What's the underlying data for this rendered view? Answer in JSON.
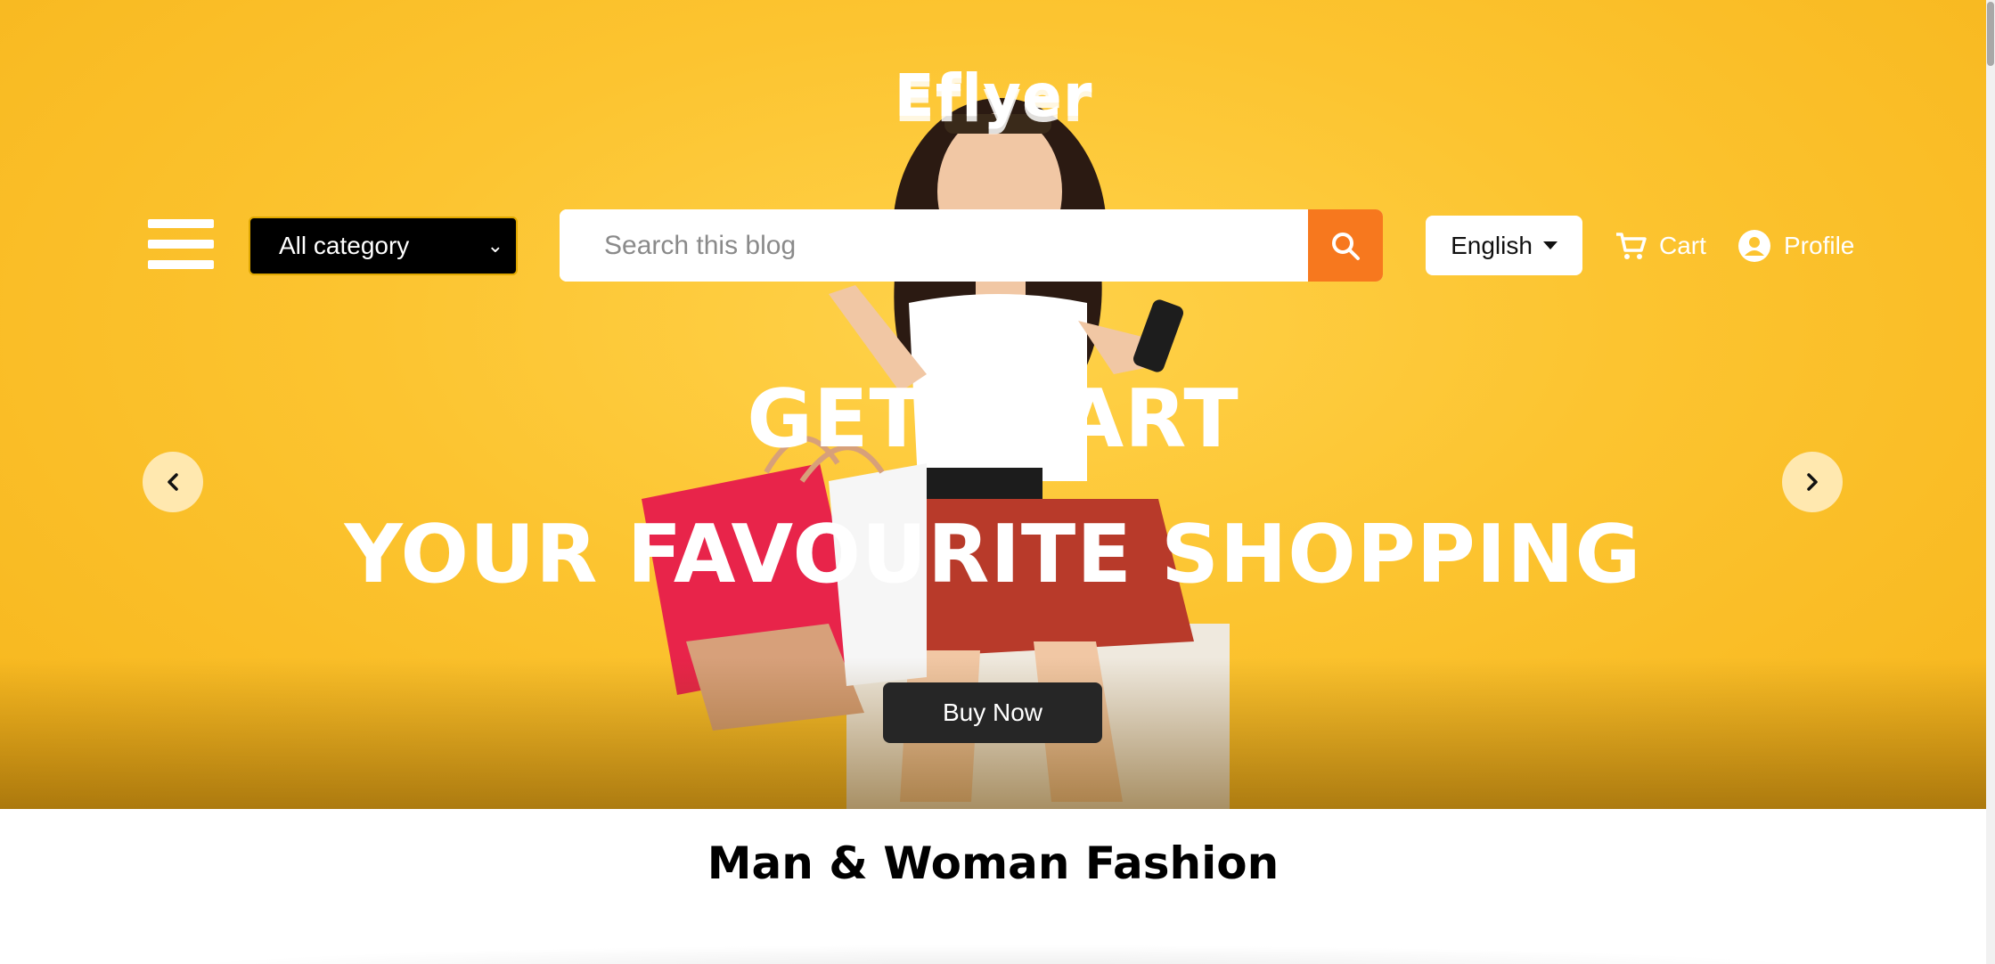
{
  "brand": {
    "logo_text": "Eflyer"
  },
  "header": {
    "category_select": {
      "selected": "All category"
    },
    "search": {
      "placeholder": "Search this blog",
      "value": ""
    },
    "language": {
      "selected": "English"
    },
    "cart_label": "Cart",
    "profile_label": "Profile",
    "icons": [
      "menu-icon",
      "chevron-down-icon",
      "search-icon",
      "caret-down-icon",
      "cart-icon",
      "user-circle-icon"
    ]
  },
  "hero": {
    "headline_line1": "GET START",
    "headline_line2": "YOUR FAVOURITE SHOPPING",
    "cta_label": "Buy Now",
    "prev_icon": "chevron-left-icon",
    "next_icon": "chevron-right-icon"
  },
  "section": {
    "title": "Man & Woman Fashion"
  },
  "colors": {
    "hero_bg": "#fcc430",
    "search_button": "#f7781e",
    "category_bg": "#000000",
    "cta_bg": "#262626"
  }
}
